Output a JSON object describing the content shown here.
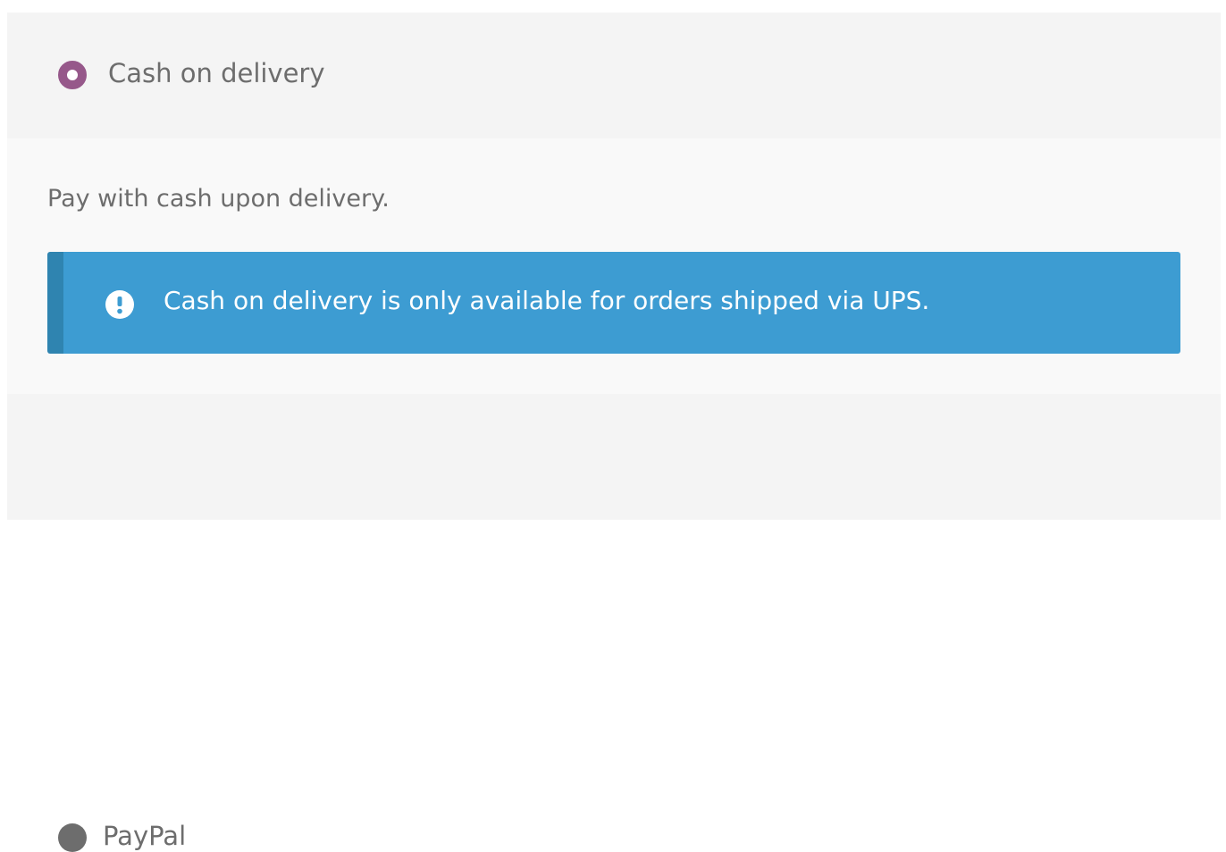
{
  "payment_methods": {
    "cod": {
      "label": "Cash on delivery",
      "selected": true,
      "description": "Pay with cash upon delivery.",
      "notice": {
        "icon": "exclamation-circle-icon",
        "text": "Cash on delivery is only available for orders shipped via UPS."
      }
    },
    "paypal": {
      "label": "PayPal",
      "selected": false
    }
  },
  "colors": {
    "accent": "#96588a",
    "notice_bg": "#3d9cd2",
    "notice_border": "#2f84b0",
    "text": "#6d6d6d"
  }
}
